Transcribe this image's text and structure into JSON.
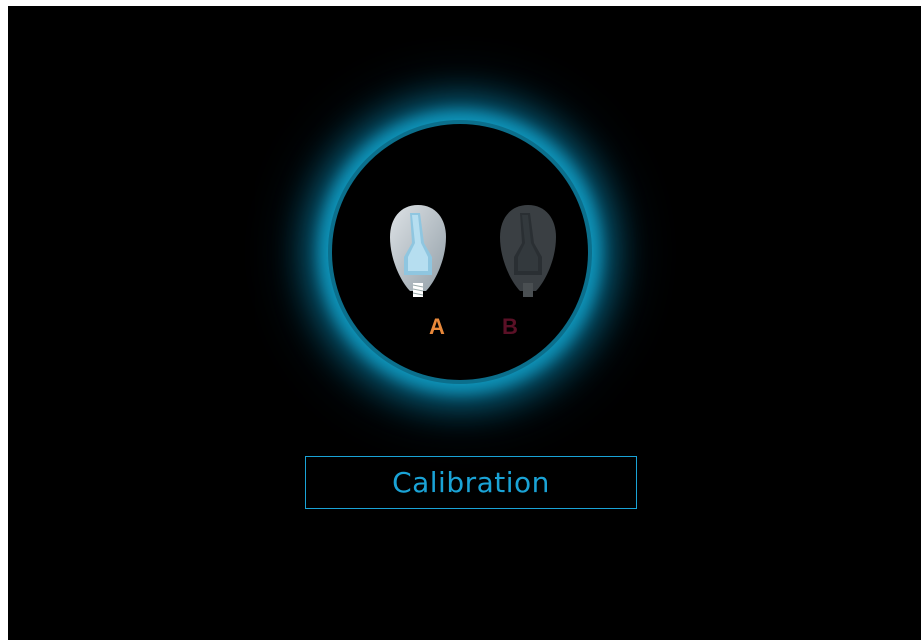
{
  "screen": {
    "background": "#000000",
    "glow_color": "#0f93b8"
  },
  "nozzles": [
    {
      "label": "A",
      "state": "active",
      "label_color": "#e8883a",
      "icon": "nozzle-a-icon"
    },
    {
      "label": "B",
      "state": "inactive",
      "label_color": "#5a1026",
      "icon": "nozzle-b-icon"
    }
  ],
  "calibration_button": {
    "label": "Calibration",
    "color": "#1aa3d6"
  }
}
